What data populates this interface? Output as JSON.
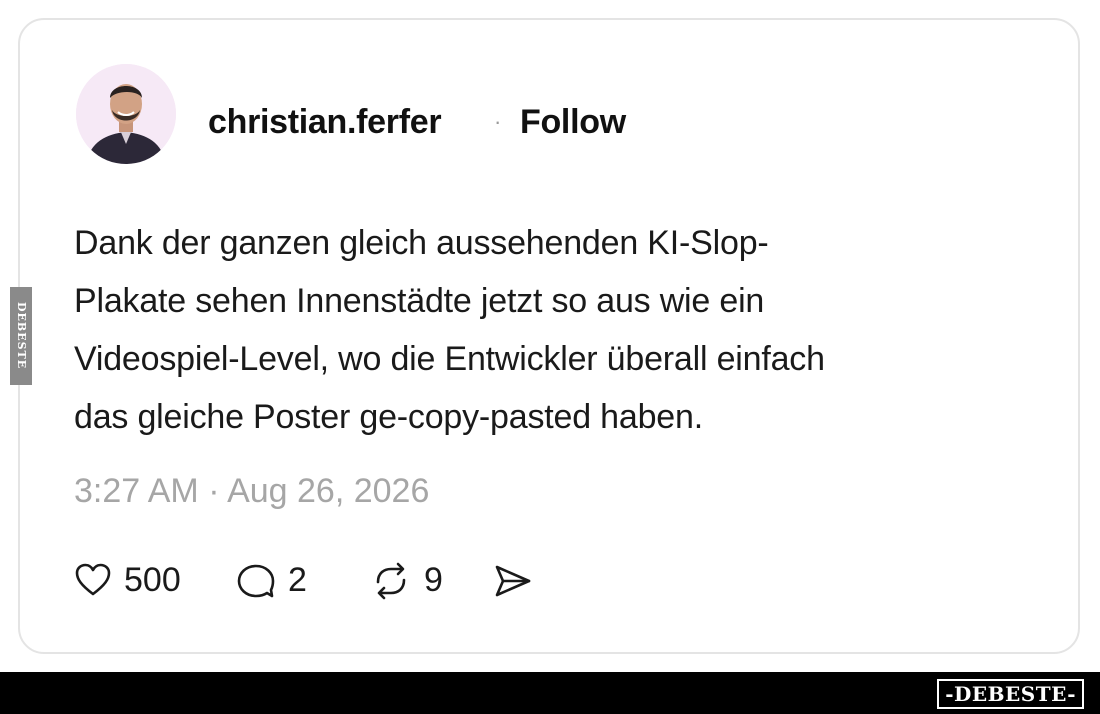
{
  "post": {
    "username": "christian.ferfer",
    "separator": "·",
    "follow_label": "Follow",
    "avatar_icon": "profile-photo",
    "text_lines": [
      "Dank der ganzen gleich aussehenden KI-Slop-",
      "Plakate sehen Innenstädte jetzt so aus wie ein",
      "Videospiel-Level, wo die Entwickler überall einfach",
      "das gleiche Poster ge-copy-pasted haben."
    ],
    "timestamp": "3:27 AM · Aug 26, 2026",
    "actions": {
      "like": {
        "icon": "heart-icon",
        "count": "500"
      },
      "reply": {
        "icon": "comment-icon",
        "count": "2"
      },
      "repost": {
        "icon": "repost-icon",
        "count": "9"
      },
      "share": {
        "icon": "send-icon"
      }
    }
  },
  "watermark": {
    "side_text": "DEBESTE",
    "bottom_text": "-DEBESTE-"
  },
  "colors": {
    "text": "#111111",
    "muted": "#a6a6a6",
    "card_border": "#e4e4e4",
    "avatar_bg": "#f6e9f6"
  }
}
